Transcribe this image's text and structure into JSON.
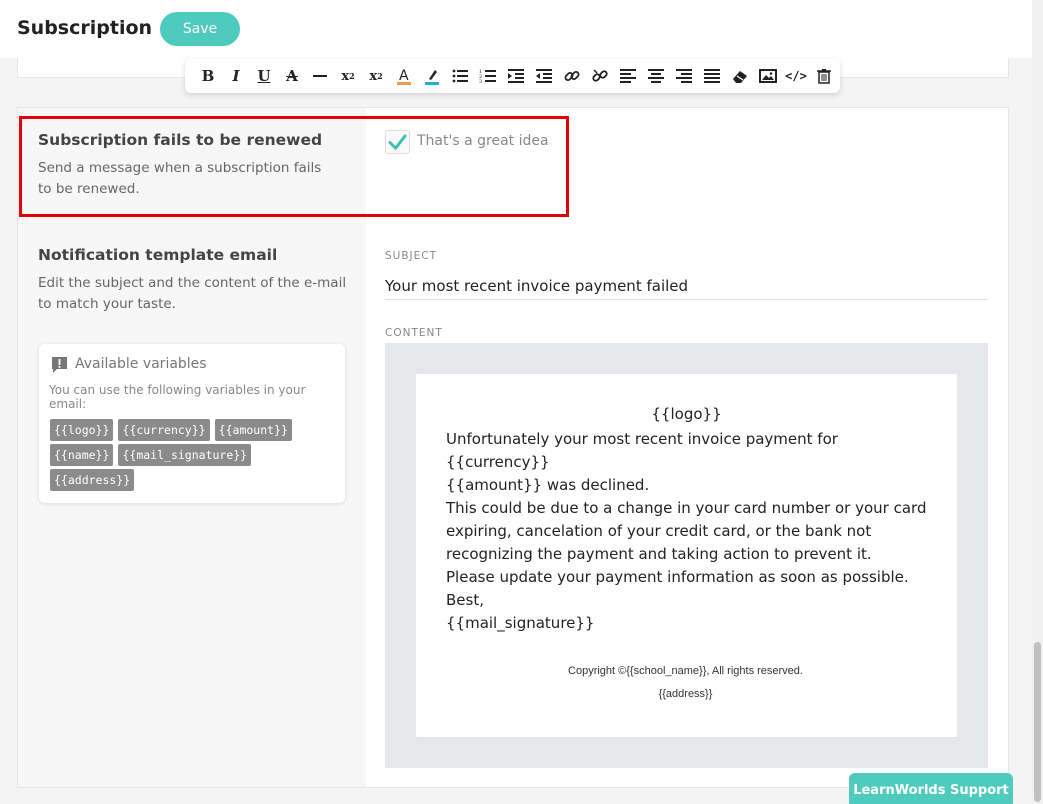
{
  "header": {
    "title": "Subscription",
    "save_label": "Save"
  },
  "toolbar": {
    "buttons": [
      {
        "name": "bold-icon",
        "glyph": "B"
      },
      {
        "name": "italic-icon",
        "glyph": "I"
      },
      {
        "name": "underline-icon",
        "glyph": "U"
      },
      {
        "name": "strikethrough-icon",
        "glyph": "A"
      },
      {
        "name": "horizontal-rule-icon",
        "glyph": "—"
      },
      {
        "name": "subscript-icon",
        "glyph": "x₂"
      },
      {
        "name": "superscript-icon",
        "glyph": "x²"
      },
      {
        "name": "text-color-icon",
        "glyph": "A"
      },
      {
        "name": "highlight-icon",
        "glyph": "✎"
      },
      {
        "name": "bullet-list-icon",
        "glyph": "≡"
      },
      {
        "name": "numbered-list-icon",
        "glyph": "≡"
      },
      {
        "name": "indent-icon",
        "glyph": "⇥"
      },
      {
        "name": "outdent-icon",
        "glyph": "⇤"
      },
      {
        "name": "link-icon",
        "glyph": "🔗"
      },
      {
        "name": "unlink-icon",
        "glyph": "⛓"
      },
      {
        "name": "align-left-icon",
        "glyph": "≡"
      },
      {
        "name": "align-center-icon",
        "glyph": "≡"
      },
      {
        "name": "align-right-icon",
        "glyph": "≡"
      },
      {
        "name": "align-justify-icon",
        "glyph": "≡"
      },
      {
        "name": "eraser-icon",
        "glyph": "⌫"
      },
      {
        "name": "image-icon",
        "glyph": "▣"
      },
      {
        "name": "code-icon",
        "glyph": "</>"
      },
      {
        "name": "trash-icon",
        "glyph": "🗑"
      }
    ]
  },
  "renewal": {
    "title": "Subscription fails to be renewed",
    "description": "Send a message when a subscription fails to be renewed.",
    "checked": true,
    "checkbox_label": "That's a great idea"
  },
  "template": {
    "title": "Notification template email",
    "description": "Edit the subject and the content of the e-mail to match your taste."
  },
  "variables": {
    "title": "Available variables",
    "description": "You can use the following variables in your email:",
    "chips": [
      "{{logo}}",
      "{{currency}}",
      "{{amount}}",
      "{{name}}",
      "{{mail_signature}}",
      "{{address}}"
    ]
  },
  "subject": {
    "label": "SUBJECT",
    "value": "Your most recent invoice payment failed"
  },
  "content": {
    "label": "CONTENT",
    "logo": "{{logo}}",
    "lines": [
      "Unfortunately your most recent invoice payment for {{currency}}",
      "{{amount}} was declined.",
      "This could be due to a change in your card number or your card",
      "expiring, cancelation of your credit card, or the bank not",
      "recognizing the payment and taking action to prevent it.",
      "Please update your payment information as soon as possible.",
      "Best,",
      "{{mail_signature}}"
    ],
    "copyright": "Copyright ©{{school_name}}, All rights reserved.",
    "address": "{{address}}"
  },
  "support": {
    "label": "LearnWorlds Support"
  },
  "colors": {
    "accent": "#4fcbbd",
    "highlight_border": "#e0000a",
    "checkmark": "#3dbfae"
  }
}
